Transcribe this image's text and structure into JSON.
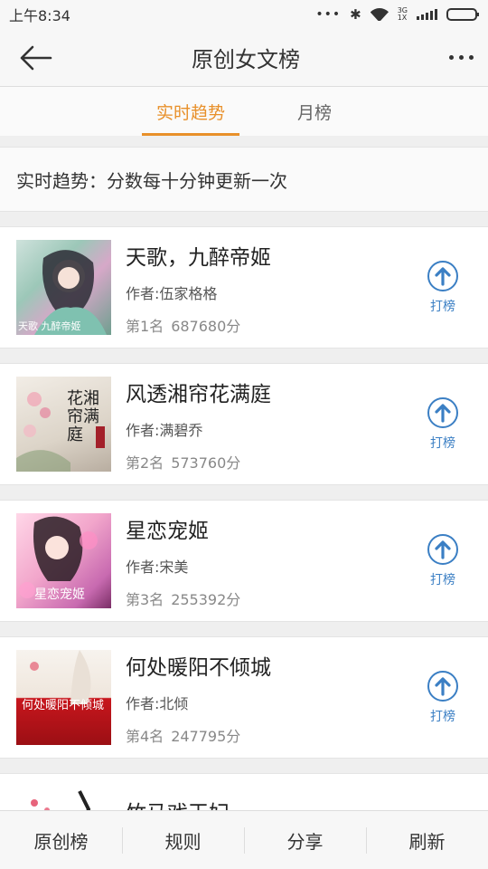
{
  "status": {
    "time": "上午8:34",
    "network": "3G\n1X",
    "battery_level": 0.9
  },
  "header": {
    "title": "原创女文榜"
  },
  "tabs": [
    {
      "label": "实时趋势",
      "active": true
    },
    {
      "label": "月榜",
      "active": false
    }
  ],
  "notice": "实时趋势：分数每十分钟更新一次",
  "books": [
    {
      "title": "天歌，九醉帝姬",
      "author": "作者:伍家格格",
      "rank": "第1名",
      "score": "687680分",
      "vote_label": "打榜"
    },
    {
      "title": "风透湘帘花满庭",
      "author": "作者:满碧乔",
      "rank": "第2名",
      "score": "573760分",
      "vote_label": "打榜"
    },
    {
      "title": "星恋宠姬",
      "author": "作者:宋美",
      "rank": "第3名",
      "score": "255392分",
      "vote_label": "打榜"
    },
    {
      "title": "何处暖阳不倾城",
      "author": "作者:北倾",
      "rank": "第4名",
      "score": "247795分",
      "vote_label": "打榜"
    },
    {
      "title": "竹马戏王妃"
    }
  ],
  "covers": [
    {
      "text": "天歌 九醉帝姬",
      "colors": [
        "#8fb8a8",
        "#d6a8c8",
        "#6f9f8f"
      ]
    },
    {
      "text": "花湘帘满庭",
      "colors": [
        "#e8e0d6",
        "#c9c2b8",
        "#a24"
      ]
    },
    {
      "text": "星恋宠姬",
      "colors": [
        "#f2b8d2",
        "#c86ab0",
        "#7a2e66"
      ]
    },
    {
      "text": "何处暖阳不倾城",
      "colors": [
        "#f6f1ea",
        "#c8161d",
        "#9b0f14"
      ]
    }
  ],
  "bottom_nav": [
    "原创榜",
    "规则",
    "分享",
    "刷新"
  ],
  "colors": {
    "accent": "#e8902a",
    "vote_blue": "#3b7fc4"
  }
}
